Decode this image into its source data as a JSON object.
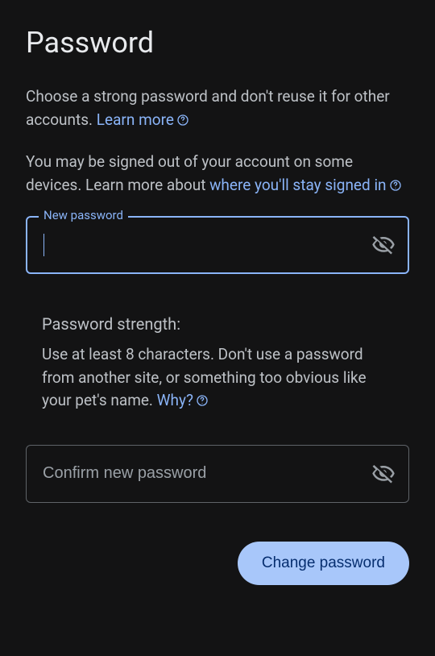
{
  "title": "Password",
  "intro": {
    "text": "Choose a strong password and don't reuse it for other accounts. ",
    "learn_more": "Learn more"
  },
  "signout_notice": {
    "prefix": "You may be signed out of your account on some devices. Learn more about ",
    "link": "where you'll stay signed in"
  },
  "new_password": {
    "label": "New password",
    "value": ""
  },
  "strength": {
    "title": "Password strength:",
    "body": "Use at least 8 characters. Don't use a password from another site, or something too obvious like your pet's name. ",
    "why": "Why?"
  },
  "confirm_password": {
    "placeholder": "Confirm new password",
    "value": ""
  },
  "submit_label": "Change password"
}
